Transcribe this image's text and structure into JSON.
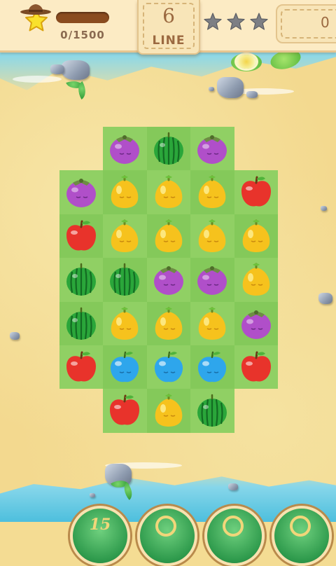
{
  "header": {
    "score": "0/1500",
    "score_progress": 0,
    "moves_count": "6",
    "moves_label": "LINE",
    "goal_stars": 3,
    "goal_stars_filled": 0,
    "coins": "0"
  },
  "board": {
    "columns": 5,
    "rows": 7,
    "cells": [
      [
        null,
        "mangosteen",
        "watermelon",
        "mangosteen",
        null
      ],
      [
        "mangosteen",
        "lemon",
        "lemon",
        "lemon",
        "apple"
      ],
      [
        "apple",
        "lemon",
        "lemon",
        "lemon",
        "lemon"
      ],
      [
        "watermelon",
        "watermelon",
        "mangosteen",
        "mangosteen",
        "lemon"
      ],
      [
        "watermelon",
        "lemon",
        "lemon",
        "lemon",
        "mangosteen"
      ],
      [
        "apple",
        "blueberry",
        "blueberry",
        "blueberry",
        "apple"
      ],
      [
        null,
        "apple",
        "lemon",
        "watermelon",
        null
      ]
    ]
  },
  "boosters": [
    {
      "label": "15"
    },
    {
      "label": ""
    },
    {
      "label": ""
    },
    {
      "label": ""
    }
  ],
  "colors": {
    "apple": "#e8332b",
    "lemon": "#f6c21d",
    "mangosteen": "#b04fc9",
    "watermelon": "#2aa63a",
    "blueberry": "#2ea6ec",
    "board_light": "#90d064",
    "board_dark": "#84c95a"
  }
}
